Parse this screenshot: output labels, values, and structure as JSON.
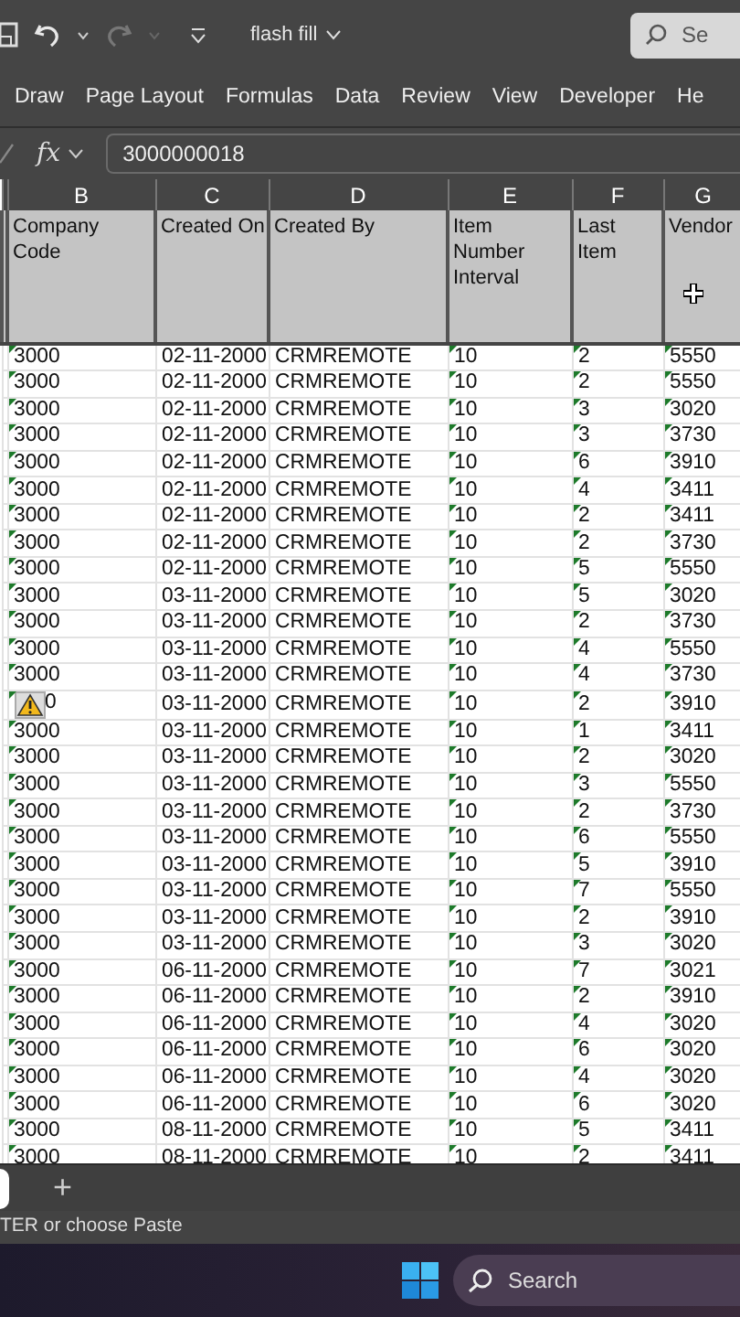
{
  "title_bar": {
    "file_name": "flash fill",
    "search_placeholder": "Se"
  },
  "ribbon_tabs": [
    {
      "label": "Draw"
    },
    {
      "label": "Page Layout"
    },
    {
      "label": "Formulas"
    },
    {
      "label": "Data"
    },
    {
      "label": "Review"
    },
    {
      "label": "View"
    },
    {
      "label": "Developer"
    },
    {
      "label": "He"
    }
  ],
  "formula_bar": {
    "fx": "fx",
    "value": "3000000018"
  },
  "columns": [
    {
      "letter": "B",
      "heading": "Company Code"
    },
    {
      "letter": "C",
      "heading": "Created On"
    },
    {
      "letter": "D",
      "heading": "Created By"
    },
    {
      "letter": "E",
      "heading": "Item Number Interval"
    },
    {
      "letter": "F",
      "heading": "Last Item"
    },
    {
      "letter": "G",
      "heading": "Vendor"
    }
  ],
  "rows": [
    {
      "cells": [
        "3000",
        "02-11-2000",
        "CRMREMOTE",
        "10",
        "2",
        "5550"
      ],
      "warning": false
    },
    {
      "cells": [
        "3000",
        "02-11-2000",
        "CRMREMOTE",
        "10",
        "2",
        "5550"
      ],
      "warning": false
    },
    {
      "cells": [
        "3000",
        "02-11-2000",
        "CRMREMOTE",
        "10",
        "3",
        "3020"
      ],
      "warning": false
    },
    {
      "cells": [
        "3000",
        "02-11-2000",
        "CRMREMOTE",
        "10",
        "3",
        "3730"
      ],
      "warning": false
    },
    {
      "cells": [
        "3000",
        "02-11-2000",
        "CRMREMOTE",
        "10",
        "6",
        "3910"
      ],
      "warning": false
    },
    {
      "cells": [
        "3000",
        "02-11-2000",
        "CRMREMOTE",
        "10",
        "4",
        "3411"
      ],
      "warning": false
    },
    {
      "cells": [
        "3000",
        "02-11-2000",
        "CRMREMOTE",
        "10",
        "2",
        "3411"
      ],
      "warning": false
    },
    {
      "cells": [
        "3000",
        "02-11-2000",
        "CRMREMOTE",
        "10",
        "2",
        "3730"
      ],
      "warning": false
    },
    {
      "cells": [
        "3000",
        "02-11-2000",
        "CRMREMOTE",
        "10",
        "5",
        "5550"
      ],
      "warning": false
    },
    {
      "cells": [
        "3000",
        "03-11-2000",
        "CRMREMOTE",
        "10",
        "5",
        "3020"
      ],
      "warning": false
    },
    {
      "cells": [
        "3000",
        "03-11-2000",
        "CRMREMOTE",
        "10",
        "2",
        "3730"
      ],
      "warning": false
    },
    {
      "cells": [
        "3000",
        "03-11-2000",
        "CRMREMOTE",
        "10",
        "4",
        "5550"
      ],
      "warning": false
    },
    {
      "cells": [
        "3000",
        "03-11-2000",
        "CRMREMOTE",
        "10",
        "4",
        "3730"
      ],
      "warning": false
    },
    {
      "cells": [
        "0",
        "03-11-2000",
        "CRMREMOTE",
        "10",
        "2",
        "3910"
      ],
      "warning": true
    },
    {
      "cells": [
        "3000",
        "03-11-2000",
        "CRMREMOTE",
        "10",
        "1",
        "3411"
      ],
      "warning": false
    },
    {
      "cells": [
        "3000",
        "03-11-2000",
        "CRMREMOTE",
        "10",
        "2",
        "3020"
      ],
      "warning": false
    },
    {
      "cells": [
        "3000",
        "03-11-2000",
        "CRMREMOTE",
        "10",
        "3",
        "5550"
      ],
      "warning": false
    },
    {
      "cells": [
        "3000",
        "03-11-2000",
        "CRMREMOTE",
        "10",
        "2",
        "3730"
      ],
      "warning": false
    },
    {
      "cells": [
        "3000",
        "03-11-2000",
        "CRMREMOTE",
        "10",
        "6",
        "5550"
      ],
      "warning": false
    },
    {
      "cells": [
        "3000",
        "03-11-2000",
        "CRMREMOTE",
        "10",
        "5",
        "3910"
      ],
      "warning": false
    },
    {
      "cells": [
        "3000",
        "03-11-2000",
        "CRMREMOTE",
        "10",
        "7",
        "5550"
      ],
      "warning": false
    },
    {
      "cells": [
        "3000",
        "03-11-2000",
        "CRMREMOTE",
        "10",
        "2",
        "3910"
      ],
      "warning": false
    },
    {
      "cells": [
        "3000",
        "03-11-2000",
        "CRMREMOTE",
        "10",
        "3",
        "3020"
      ],
      "warning": false
    },
    {
      "cells": [
        "3000",
        "06-11-2000",
        "CRMREMOTE",
        "10",
        "7",
        "3021"
      ],
      "warning": false
    },
    {
      "cells": [
        "3000",
        "06-11-2000",
        "CRMREMOTE",
        "10",
        "2",
        "3910"
      ],
      "warning": false
    },
    {
      "cells": [
        "3000",
        "06-11-2000",
        "CRMREMOTE",
        "10",
        "4",
        "3020"
      ],
      "warning": false
    },
    {
      "cells": [
        "3000",
        "06-11-2000",
        "CRMREMOTE",
        "10",
        "6",
        "3020"
      ],
      "warning": false
    },
    {
      "cells": [
        "3000",
        "06-11-2000",
        "CRMREMOTE",
        "10",
        "4",
        "3020"
      ],
      "warning": false
    },
    {
      "cells": [
        "3000",
        "06-11-2000",
        "CRMREMOTE",
        "10",
        "6",
        "3020"
      ],
      "warning": false
    },
    {
      "cells": [
        "3000",
        "08-11-2000",
        "CRMREMOTE",
        "10",
        "5",
        "3411"
      ],
      "warning": false
    },
    {
      "cells": [
        "3000",
        "08-11-2000",
        "CRMREMOTE",
        "10",
        "2",
        "3411"
      ],
      "warning": false
    }
  ],
  "sheet_bar": {
    "add": "+"
  },
  "status_bar": {
    "message": "TER or choose Paste"
  },
  "taskbar": {
    "search": "Search"
  }
}
